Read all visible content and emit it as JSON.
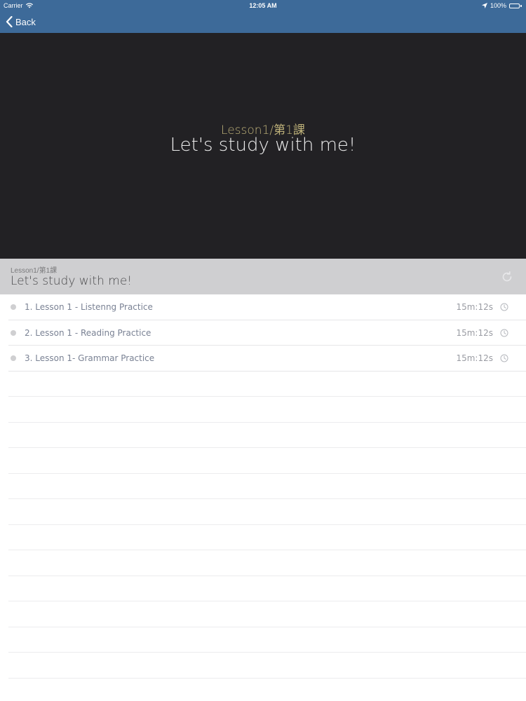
{
  "status_bar": {
    "carrier": "Carrier",
    "time": "12:05 AM",
    "battery": "100%",
    "battery_color": "#6fe05a"
  },
  "navbar": {
    "back_label": "Back",
    "color": "#3d6a99"
  },
  "video": {
    "subtitle": "Lesson1/第1課",
    "title": "Let's study with me!"
  },
  "header": {
    "subtitle": "Lesson1/第1課",
    "title": "Let's study with me!",
    "action_icon": "refresh-icon"
  },
  "lessons": [
    {
      "label": "1. Lesson 1 - Listenng Practice",
      "duration": "15m:12s",
      "icon": "clock-icon"
    },
    {
      "label": "2. Lesson 1 - Reading Practice",
      "duration": "15m:12s",
      "icon": "clock-icon"
    },
    {
      "label": "3. Lesson 1- Grammar Practice",
      "duration": "15m:12s",
      "icon": "clock-icon"
    }
  ]
}
